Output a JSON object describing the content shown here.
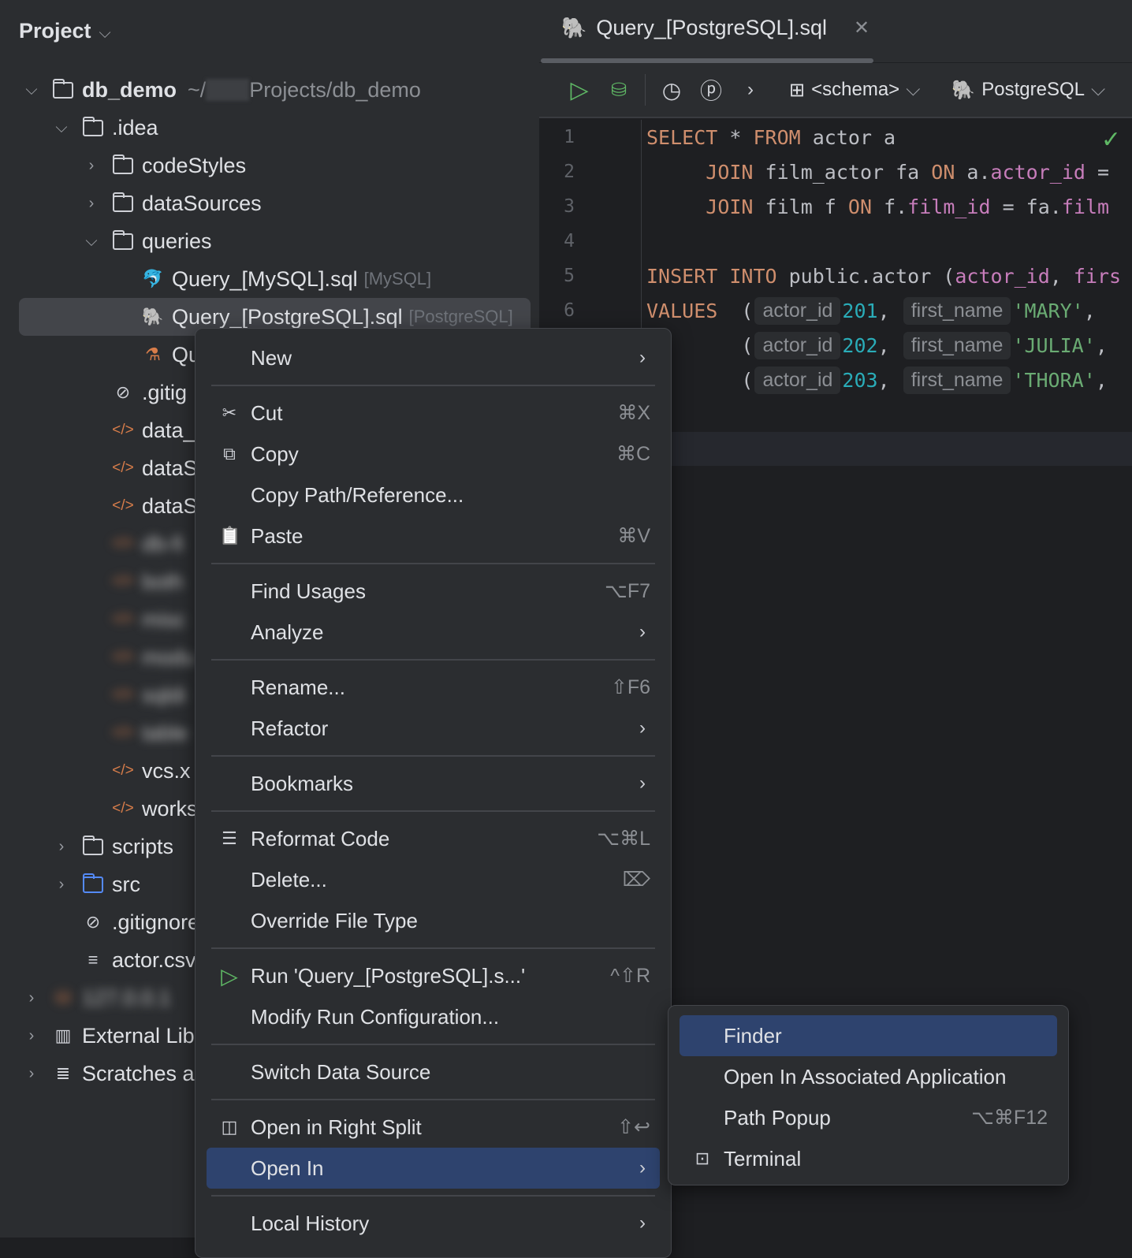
{
  "sidebar": {
    "title": "Project",
    "tree": [
      {
        "label": "db_demo",
        "path": "~/",
        "path2": "Projects/db_demo",
        "arrow": "open",
        "icon": "project-folder-icon",
        "depth": 0,
        "bold": true
      },
      {
        "label": ".idea",
        "arrow": "open",
        "icon": "folder-icon",
        "depth": 1
      },
      {
        "label": "codeStyles",
        "arrow": "closed",
        "icon": "folder-icon",
        "depth": 2
      },
      {
        "label": "dataSources",
        "arrow": "closed",
        "icon": "folder-icon",
        "depth": 2
      },
      {
        "label": "queries",
        "arrow": "open",
        "icon": "folder-icon",
        "depth": 2
      },
      {
        "label": "Query_[MySQL].sql",
        "hint": "[MySQL]",
        "icon": "mysql-icon",
        "depth": 3
      },
      {
        "label": "Query_[PostgreSQL].sql",
        "hint": "[PostgreSQL]",
        "icon": "postgresql-icon",
        "depth": 3,
        "selected": true
      },
      {
        "label": "Qu",
        "icon": "sqlserver-icon",
        "depth": 3
      },
      {
        "label": ".gitig",
        "icon": "ignore-icon",
        "depth": 2
      },
      {
        "label": "data_",
        "icon": "xml-icon",
        "depth": 2
      },
      {
        "label": "dataS",
        "icon": "xml-icon",
        "depth": 2
      },
      {
        "label": "dataS",
        "icon": "xml-icon",
        "depth": 2
      },
      {
        "label": "db-fi",
        "icon": "xml-icon",
        "depth": 2,
        "blurred": true
      },
      {
        "label": "both",
        "icon": "xml-icon",
        "depth": 2,
        "blurred": true
      },
      {
        "label": "misc",
        "icon": "xml-icon",
        "depth": 2,
        "blurred": true
      },
      {
        "label": "modu",
        "icon": "xml-icon",
        "depth": 2,
        "blurred": true
      },
      {
        "label": "sqldi",
        "icon": "xml-icon",
        "depth": 2,
        "blurred": true
      },
      {
        "label": "table",
        "icon": "xml-icon",
        "depth": 2,
        "blurred": true
      },
      {
        "label": "vcs.x",
        "icon": "xml-icon",
        "depth": 2
      },
      {
        "label": "works",
        "icon": "xml-icon",
        "depth": 2
      },
      {
        "label": "scripts",
        "arrow": "closed",
        "icon": "folder-icon",
        "depth": 1
      },
      {
        "label": "src",
        "arrow": "closed",
        "icon": "source-folder-icon",
        "depth": 1
      },
      {
        "label": ".gitignore",
        "icon": "ignore-icon",
        "depth": 1
      },
      {
        "label": "actor.csv",
        "icon": "text-file-icon",
        "depth": 1
      },
      {
        "label": "127.0.0.1",
        "arrow": "closed",
        "icon": "datasource-icon",
        "depth": 0,
        "blurred": true
      },
      {
        "label": "External Lib",
        "arrow": "closed",
        "icon": "library-icon",
        "depth": 0
      },
      {
        "label": "Scratches a",
        "arrow": "closed",
        "icon": "scratches-icon",
        "depth": 0
      }
    ]
  },
  "editor": {
    "tab": {
      "label": "Query_[PostgreSQL].sql"
    },
    "toolbar": {
      "schema": "<schema>",
      "datasource": "PostgreSQL"
    },
    "lines": [
      [
        [
          "kw",
          "SELECT"
        ],
        [
          "tx",
          " * "
        ],
        [
          "kw",
          "FROM"
        ],
        [
          "tx",
          " actor a"
        ]
      ],
      [
        [
          "tx",
          "     "
        ],
        [
          "kw",
          "JOIN"
        ],
        [
          "tx",
          " film_actor fa "
        ],
        [
          "kw",
          "ON"
        ],
        [
          "tx",
          " a."
        ],
        [
          "col",
          "actor_id"
        ],
        [
          "tx",
          " ="
        ]
      ],
      [
        [
          "tx",
          "     "
        ],
        [
          "kw",
          "JOIN"
        ],
        [
          "tx",
          " film f "
        ],
        [
          "kw",
          "ON"
        ],
        [
          "tx",
          " f."
        ],
        [
          "col",
          "film_id"
        ],
        [
          "tx",
          " = fa."
        ],
        [
          "col",
          "film"
        ]
      ],
      [],
      [
        [
          "kw",
          "INSERT INTO"
        ],
        [
          "tx",
          " public.actor ("
        ],
        [
          "col",
          "actor_id"
        ],
        [
          "tx",
          ", "
        ],
        [
          "col",
          "firs"
        ]
      ],
      [
        [
          "kw",
          "VALUES"
        ],
        [
          "tx",
          "  ("
        ],
        [
          "inlay",
          "actor_id"
        ],
        [
          "num",
          "201"
        ],
        [
          "tx",
          ", "
        ],
        [
          "inlay",
          "first_name"
        ],
        [
          "str",
          "'MARY'"
        ],
        [
          "tx",
          ","
        ]
      ],
      [
        [
          "tx",
          "        ("
        ],
        [
          "inlay",
          "actor_id"
        ],
        [
          "num",
          "202"
        ],
        [
          "tx",
          ", "
        ],
        [
          "inlay",
          "first_name"
        ],
        [
          "str",
          "'JULIA'"
        ],
        [
          "tx",
          ","
        ]
      ],
      [
        [
          "tx",
          "        ("
        ],
        [
          "inlay",
          "actor_id"
        ],
        [
          "num",
          "203"
        ],
        [
          "tx",
          ", "
        ],
        [
          "inlay",
          "first_name"
        ],
        [
          "str",
          "'THORA'"
        ],
        [
          "tx",
          ","
        ]
      ]
    ],
    "line_numbers": [
      "1",
      "2",
      "3",
      "4",
      "5",
      "6"
    ]
  },
  "context_menu": [
    {
      "label": "New",
      "submenu": true
    },
    {
      "sep": true
    },
    {
      "label": "Cut",
      "icon": "scissors-icon",
      "shortcut": "⌘X"
    },
    {
      "label": "Copy",
      "icon": "copy-icon",
      "shortcut": "⌘C"
    },
    {
      "label": "Copy Path/Reference..."
    },
    {
      "label": "Paste",
      "icon": "paste-icon",
      "shortcut": "⌘V"
    },
    {
      "sep": true
    },
    {
      "label": "Find Usages",
      "shortcut": "⌥F7"
    },
    {
      "label": "Analyze",
      "submenu": true
    },
    {
      "sep": true
    },
    {
      "label": "Rename...",
      "shortcut": "⇧F6"
    },
    {
      "label": "Refactor",
      "submenu": true
    },
    {
      "sep": true
    },
    {
      "label": "Bookmarks",
      "submenu": true
    },
    {
      "sep": true
    },
    {
      "label": "Reformat Code",
      "icon": "reformat-icon",
      "shortcut": "⌥⌘L"
    },
    {
      "label": "Delete...",
      "shortcut": "⌦"
    },
    {
      "label": "Override File Type"
    },
    {
      "sep": true
    },
    {
      "label": "Run 'Query_[PostgreSQL].s...'",
      "icon": "run-icon",
      "shortcut": "^⇧R"
    },
    {
      "label": "Modify Run Configuration..."
    },
    {
      "sep": true
    },
    {
      "label": "Switch Data Source"
    },
    {
      "sep": true
    },
    {
      "label": "Open in Right Split",
      "icon": "split-icon",
      "shortcut": "⇧↩"
    },
    {
      "label": "Open In",
      "submenu": true,
      "active": true
    },
    {
      "sep": true
    },
    {
      "label": "Local History",
      "submenu": true
    }
  ],
  "submenu": [
    {
      "label": "Finder",
      "active": true
    },
    {
      "label": "Open In Associated Application"
    },
    {
      "label": "Path Popup",
      "shortcut": "⌥⌘F12"
    },
    {
      "label": "Terminal",
      "icon": "terminal-icon"
    }
  ],
  "colors": {
    "accent": "#2e436e",
    "keyword": "#cf8e6d",
    "column": "#c77dbb",
    "number": "#2aacb8",
    "string": "#6aab73"
  }
}
